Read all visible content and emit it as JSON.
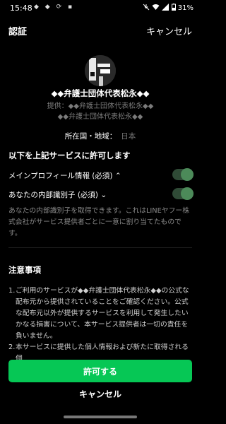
{
  "status_bar": {
    "time": "15:48",
    "left_icons": "◆ ◆ ⟳ ▪",
    "battery": "31%",
    "icons": [
      "mute-icon",
      "wifi-icon",
      "signal-icon",
      "battery-icon"
    ]
  },
  "header": {
    "title": "認証",
    "cancel_label": "キャンセル"
  },
  "service": {
    "name": "◆◆弁護士団体代表松永◆◆",
    "provider": "提供：◆◆弁護士団体代表松永◆◆",
    "provider_line2": "◆◆弁護士団体代表松永◆◆",
    "country_label": "所在国・地域：",
    "country_value": "日本"
  },
  "permissions": {
    "title": "以下を上記サービスに許可します",
    "items": [
      {
        "label": "メインプロフィール情報 (必須) ⌃",
        "enabled": true
      },
      {
        "label": "あなたの内部識別子 (必須) ⌄",
        "enabled": true
      }
    ],
    "description": "あなたの内部識別子を取得できます。これはLINEヤフー株式会社がサービス提供者ごとに一意に割り当てたものです。"
  },
  "notice": {
    "title": "注意事項",
    "items": [
      {
        "num": "1.",
        "text": "ご利用のサービスが◆◆弁護士団体代表松永◆◆の公式な配布元から提供されていることをご確認ください。公式な配布元以外が提供するサービスを利用して発生したいかなる損害について、本サービス提供者は一切の責任を負いません。"
      },
      {
        "num": "2.",
        "text": "本サービスに提供した個人情報および新たに取得される個"
      }
    ]
  },
  "actions": {
    "allow_label": "許可する",
    "cancel_label": "キャンセル"
  },
  "colors": {
    "accent": "#06c755",
    "toggle_track": "#2f4a36",
    "toggle_knob": "#4c8a59",
    "background": "#000000"
  }
}
